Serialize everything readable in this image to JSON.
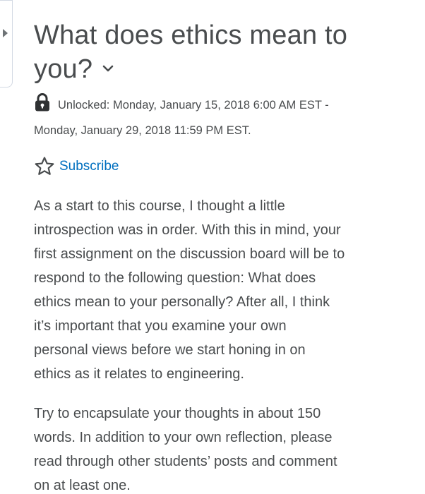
{
  "topic": {
    "title_line1": "What does ethics mean to",
    "title_line2": "you?",
    "availability_line1": "Unlocked: Monday, January 15, 2018 6:00 AM EST -",
    "availability_line2": "Monday, January 29, 2018 11:59 PM EST."
  },
  "actions": {
    "subscribe_label": "Subscribe"
  },
  "description": {
    "paragraph1_lines": [
      "As a start to this course, I thought a little",
      "introspection was in order. With this in mind, your",
      "first assignment on the discussion board will be to",
      "respond to the following question: What does",
      "ethics mean to your personally? After all, I think",
      "it’s important that you examine your own",
      "personal views before we start honing in on",
      "ethics as it relates to engineering."
    ],
    "paragraph2_lines": [
      "Try to encapsulate your thoughts in about 150",
      "words. In addition to your own reflection, please",
      "read through other students’ posts and comment",
      "on at least one."
    ]
  },
  "icons": {
    "side_toggle": "caret-right-icon",
    "title_menu": "chevron-down-icon",
    "lock": "lock-icon",
    "subscribe": "star-outline-icon"
  },
  "colors": {
    "text": "#494c4e",
    "link": "#006fbf",
    "border": "#d3d9e3"
  }
}
